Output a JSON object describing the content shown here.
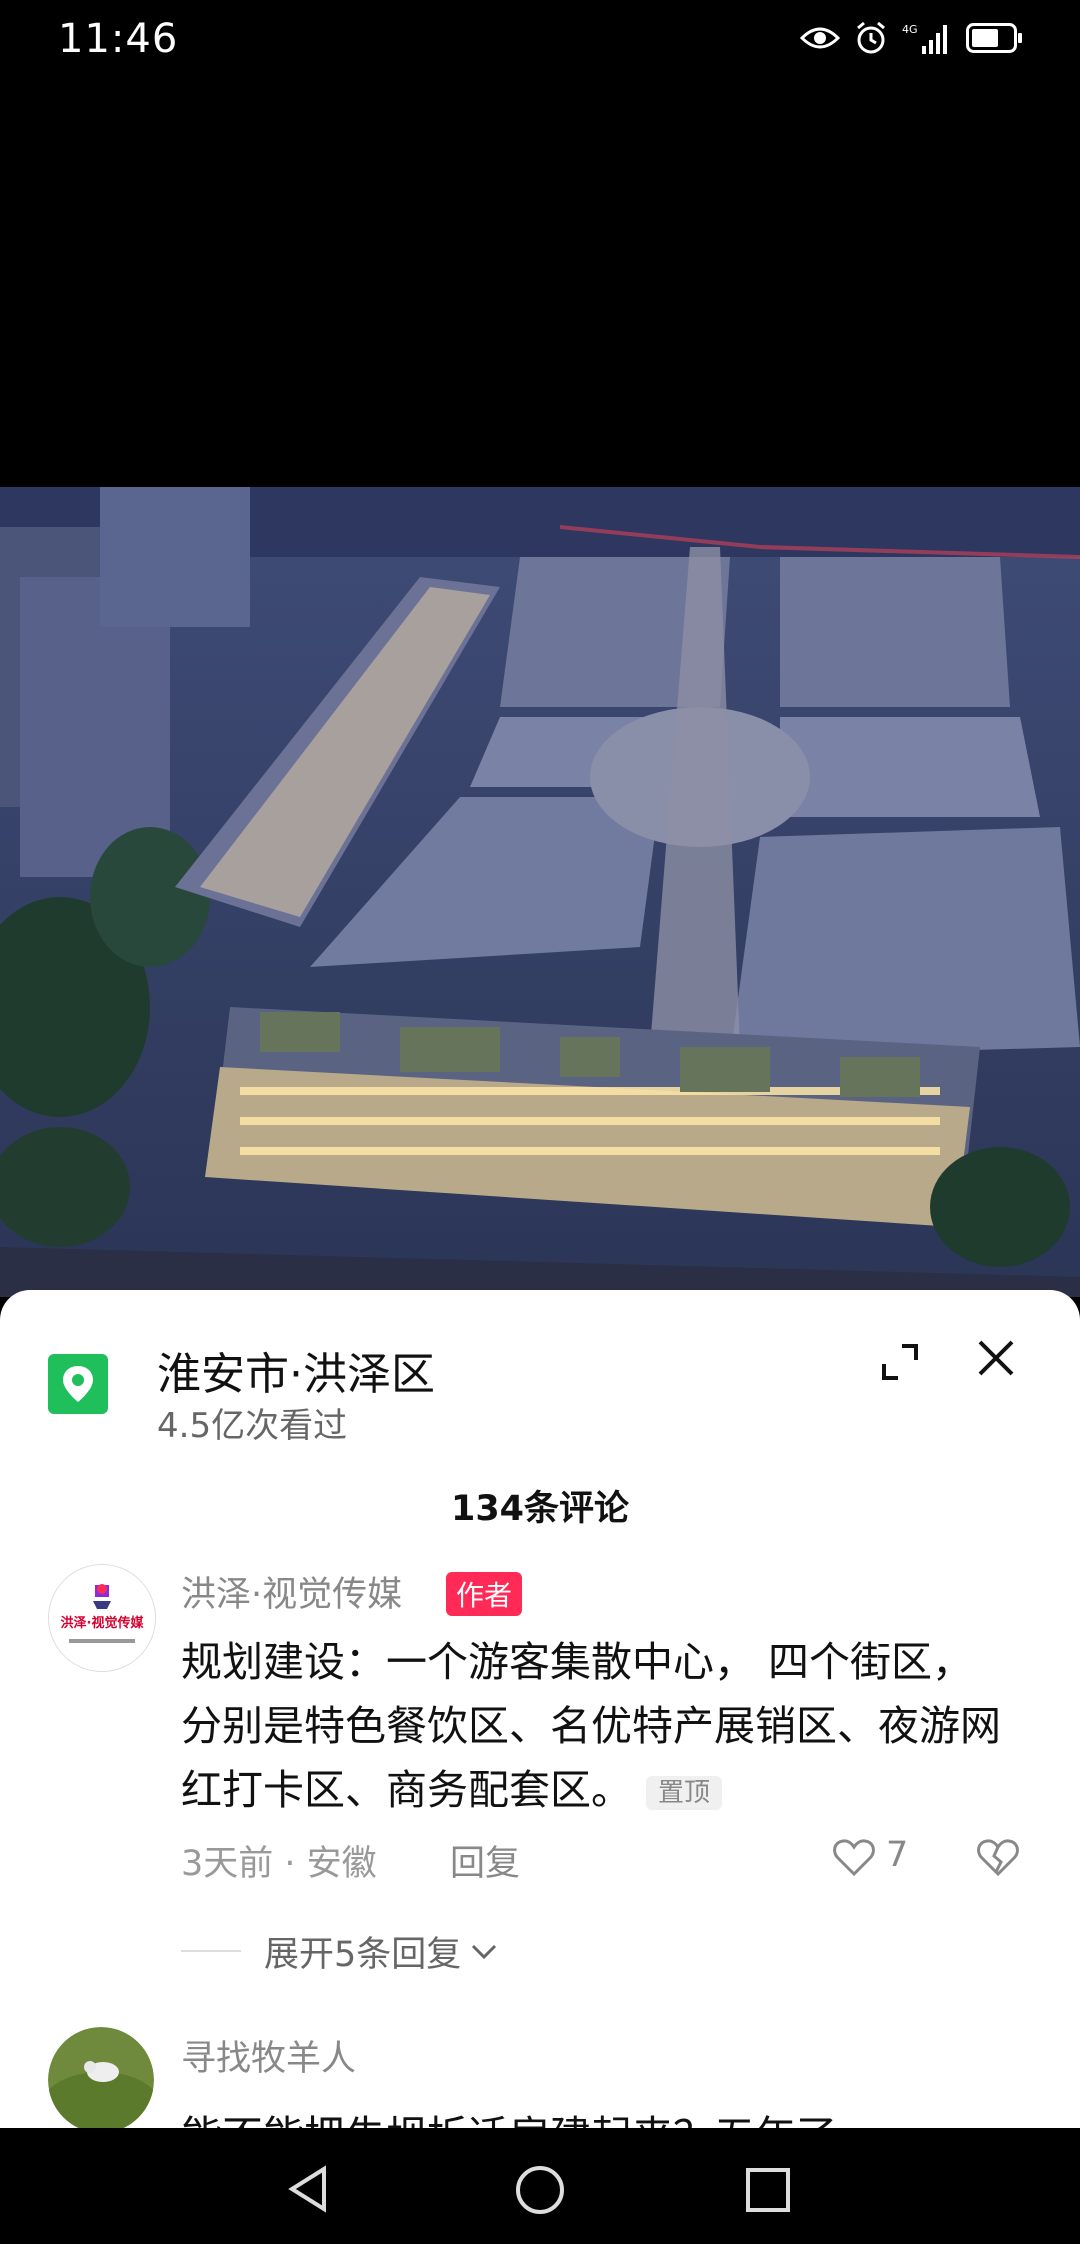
{
  "status_bar": {
    "time": "11:46",
    "icons": [
      "eye-icon",
      "alarm-icon",
      "4g-signal-icon",
      "battery-icon"
    ]
  },
  "location": {
    "title": "淮安市·洪泽区",
    "views": "4.5亿次看过"
  },
  "comments_header": "134条评论",
  "comments": [
    {
      "author": "洪泽·视觉传媒",
      "badge": "作者",
      "text": "规划建设：一个游客集散中心， 四个街区，分别是特色餐饮区、名优特产展销区、夜游网红打卡区、商务配套区。",
      "pinned_label": "置顶",
      "time_location": "3天前 · 安徽",
      "reply_label": "回复",
      "likes": "7",
      "expand_label": "展开5条回复",
      "avatar_text": "洪泽·视觉传媒"
    },
    {
      "author": "寻找牧羊人",
      "text": "能不能把朱坝拆迁房建起来？五年了，一"
    }
  ],
  "colors": {
    "accent_green": "#1fbf5b",
    "author_badge": "#ff2a55"
  }
}
